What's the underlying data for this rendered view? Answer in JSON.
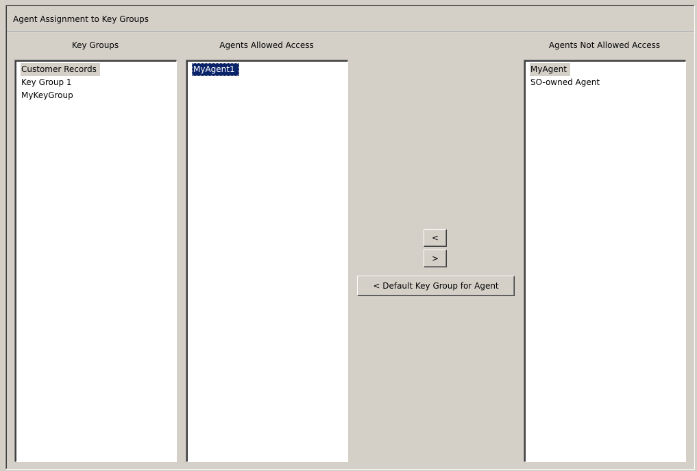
{
  "window": {
    "title": "Agent Assignment to Key Groups"
  },
  "key_groups": {
    "header": "Key Groups",
    "items": [
      "Customer Records",
      "Key Group 1",
      "MyKeyGroup"
    ],
    "highlighted": "Customer Records"
  },
  "allowed": {
    "header": "Agents Allowed Access",
    "items": [
      "MyAgent1"
    ],
    "selected": "MyAgent1"
  },
  "not_allowed": {
    "header": "Agents Not Allowed Access",
    "items": [
      "MyAgent",
      "SO-owned Agent"
    ],
    "highlighted": "MyAgent"
  },
  "buttons": {
    "move_left": "<",
    "move_right": ">",
    "default_group": "< Default Key Group for Agent"
  }
}
